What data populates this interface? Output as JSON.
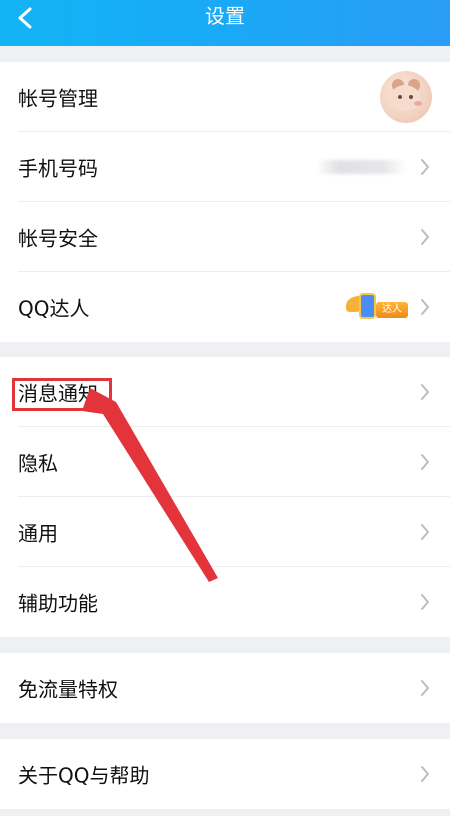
{
  "header": {
    "title": "设置",
    "back_icon": "chevron-left-icon"
  },
  "groups": [
    {
      "rows": [
        {
          "label": "帐号管理",
          "accessory": "avatar"
        },
        {
          "label": "手机号码",
          "accessory": "blurred-value"
        },
        {
          "label": "帐号安全"
        },
        {
          "label": "QQ达人",
          "badge_text": "达人"
        }
      ]
    },
    {
      "rows": [
        {
          "label": "消息通知"
        },
        {
          "label": "隐私"
        },
        {
          "label": "通用"
        },
        {
          "label": "辅助功能"
        }
      ]
    },
    {
      "rows": [
        {
          "label": "免流量特权"
        }
      ]
    },
    {
      "rows": [
        {
          "label": "关于QQ与帮助"
        }
      ]
    }
  ],
  "annotation": {
    "highlight_color": "#e3343c",
    "highlight_target": "消息通知"
  },
  "colors": {
    "header_start": "#12b4f5",
    "header_end": "#2a9cf6",
    "background": "#eef0f4",
    "row_text": "#111111",
    "chevron": "#b9bcc2"
  }
}
